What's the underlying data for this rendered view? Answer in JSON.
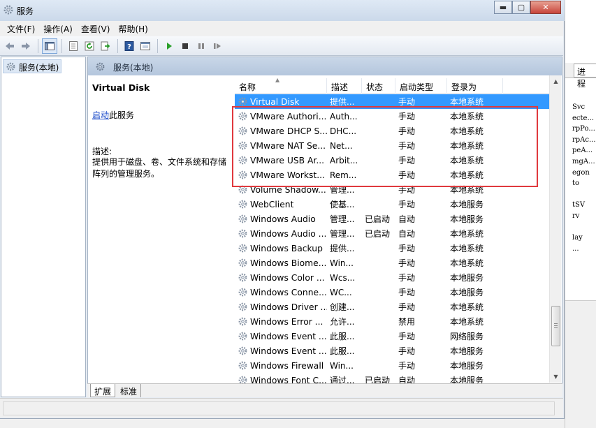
{
  "window": {
    "title": "服务",
    "minimize": "▬",
    "maximize": "▢",
    "close": "✕"
  },
  "menu": [
    "文件(F)",
    "操作(A)",
    "查看(V)",
    "帮助(H)"
  ],
  "toolbar": [
    "back-icon",
    "forward-icon",
    "show-tree-icon",
    "properties-icon",
    "refresh-icon",
    "export-icon",
    "help-icon",
    "console-icon",
    "start-icon",
    "stop-icon",
    "pause-icon",
    "restart-icon"
  ],
  "tree": {
    "root": "服务(本地)"
  },
  "pane": {
    "header": "服务(本地)",
    "service_name": "Virtual Disk",
    "start_link": "启动",
    "start_suffix": "此服务",
    "description_label": "描述:",
    "description_text": "提供用于磁盘、卷、文件系统和存储阵列的管理服务。"
  },
  "list": {
    "columns": [
      "名称",
      "描述",
      "状态",
      "启动类型",
      "登录为"
    ],
    "rows": [
      {
        "name": "Virtual Disk",
        "desc": "提供...",
        "status": "",
        "startup": "手动",
        "logon": "本地系统",
        "selected": true
      },
      {
        "name": "VMware Authori...",
        "desc": "Auth...",
        "status": "",
        "startup": "手动",
        "logon": "本地系统"
      },
      {
        "name": "VMware DHCP S...",
        "desc": "DHC...",
        "status": "",
        "startup": "手动",
        "logon": "本地系统"
      },
      {
        "name": "VMware NAT Se...",
        "desc": "Net...",
        "status": "",
        "startup": "手动",
        "logon": "本地系统"
      },
      {
        "name": "VMware USB Ar...",
        "desc": "Arbit...",
        "status": "",
        "startup": "手动",
        "logon": "本地系统"
      },
      {
        "name": "VMware Workst...",
        "desc": "Rem...",
        "status": "",
        "startup": "手动",
        "logon": "本地系统"
      },
      {
        "name": "Volume Shadow...",
        "desc": "管理...",
        "status": "",
        "startup": "手动",
        "logon": "本地系统"
      },
      {
        "name": "WebClient",
        "desc": "使基...",
        "status": "",
        "startup": "手动",
        "logon": "本地服务"
      },
      {
        "name": "Windows Audio",
        "desc": "管理...",
        "status": "已启动",
        "startup": "自动",
        "logon": "本地服务"
      },
      {
        "name": "Windows Audio ...",
        "desc": "管理...",
        "status": "已启动",
        "startup": "自动",
        "logon": "本地系统"
      },
      {
        "name": "Windows Backup",
        "desc": "提供...",
        "status": "",
        "startup": "手动",
        "logon": "本地系统"
      },
      {
        "name": "Windows Biome...",
        "desc": "Win...",
        "status": "",
        "startup": "手动",
        "logon": "本地系统"
      },
      {
        "name": "Windows Color ...",
        "desc": "Wcs...",
        "status": "",
        "startup": "手动",
        "logon": "本地服务"
      },
      {
        "name": "Windows Conne...",
        "desc": "WC...",
        "status": "",
        "startup": "手动",
        "logon": "本地服务"
      },
      {
        "name": "Windows Driver ...",
        "desc": "创建...",
        "status": "",
        "startup": "手动",
        "logon": "本地系统"
      },
      {
        "name": "Windows Error ...",
        "desc": "允许...",
        "status": "",
        "startup": "禁用",
        "logon": "本地系统"
      },
      {
        "name": "Windows Event ...",
        "desc": "此服...",
        "status": "",
        "startup": "手动",
        "logon": "网络服务"
      },
      {
        "name": "Windows Event ...",
        "desc": "此服...",
        "status": "",
        "startup": "手动",
        "logon": "本地服务"
      },
      {
        "name": "Windows Firewall",
        "desc": "Win...",
        "status": "",
        "startup": "手动",
        "logon": "本地服务"
      },
      {
        "name": "Windows Font C...",
        "desc": "通过...",
        "status": "已启动",
        "startup": "自动",
        "logon": "本地服务"
      }
    ]
  },
  "bottom_tabs": [
    "扩展",
    "标准"
  ],
  "background_window": {
    "tab": "进程",
    "fragments": [
      "Svc",
      "ecte...",
      "rpPo...",
      "rpAc...",
      "peA...",
      "mgA...",
      "egon",
      "to",
      "",
      "tSV",
      "rv",
      "",
      "lay",
      "..."
    ]
  },
  "colors": {
    "selection": "#3399ff",
    "highlight_box": "#e0393e",
    "link": "#1a4ac9"
  }
}
